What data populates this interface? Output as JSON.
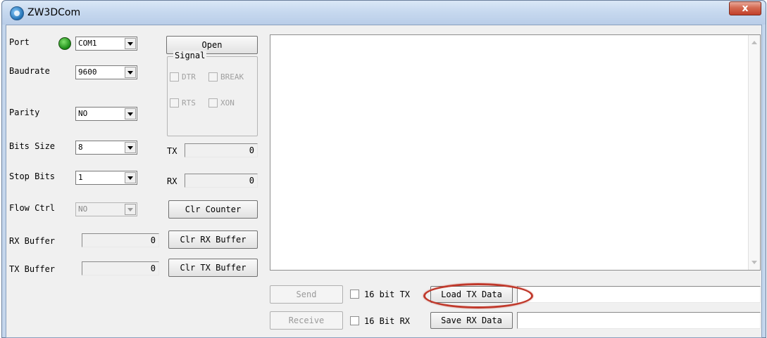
{
  "window": {
    "title": "ZW3DCom",
    "close_glyph": "x"
  },
  "left_panel": {
    "port_label": "Port",
    "port_value": "COM1",
    "baudrate_label": "Baudrate",
    "baudrate_value": "9600",
    "parity_label": "Parity",
    "parity_value": "NO",
    "bits_label": "Bits Size",
    "bits_value": "8",
    "stop_label": "Stop Bits",
    "stop_value": "1",
    "flow_label": "Flow Ctrl",
    "flow_value": "NO",
    "rxbuf_label": "RX Buffer",
    "rxbuf_value": "0",
    "txbuf_label": "TX Buffer",
    "txbuf_value": "0"
  },
  "mid_panel": {
    "open_label": "Open",
    "signal_legend": "Signal",
    "dtr_label": "DTR",
    "break_label": "BREAK",
    "rts_label": "RTS",
    "xon_label": "XON",
    "tx_label": "TX",
    "tx_value": "0",
    "rx_label": "RX",
    "rx_value": "0",
    "clr_counter_label": "Clr Counter",
    "clr_rx_label": "Clr RX Buffer",
    "clr_tx_label": "Clr TX Buffer"
  },
  "bottom": {
    "send_label": "Send",
    "hex_tx_label": "16 bit TX",
    "load_tx_label": "Load TX Data",
    "tx_path": "",
    "receive_label": "Receive",
    "hex_rx_label": "16 Bit RX",
    "save_rx_label": "Save RX Data",
    "rx_path": ""
  },
  "colors": {
    "led_green": "#1a8a16",
    "highlight_red": "#c0392b",
    "close_red": "#c2402a"
  }
}
